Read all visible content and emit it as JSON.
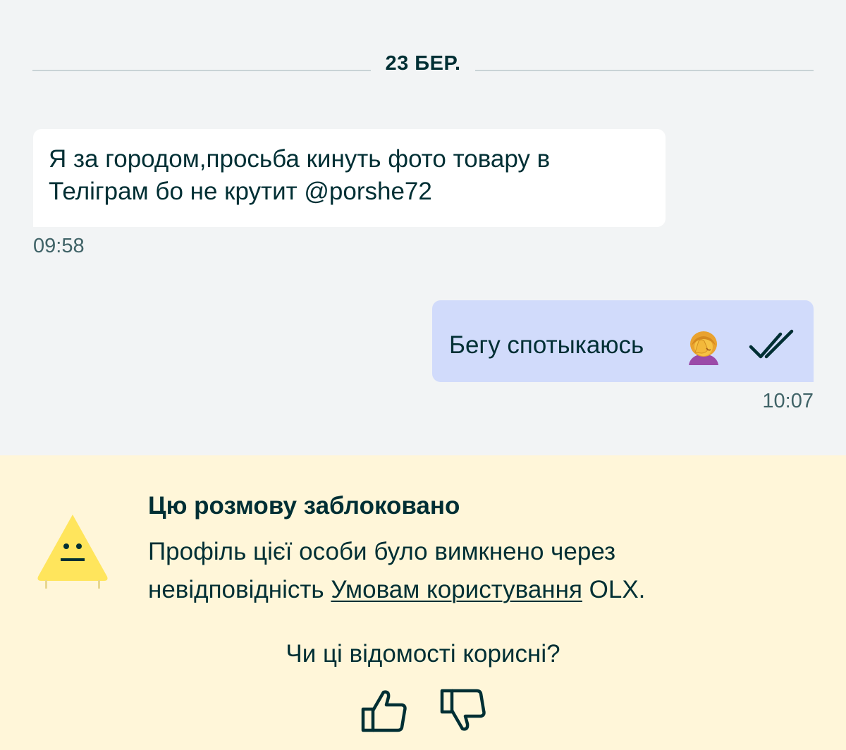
{
  "date_separator": "23 БЕР.",
  "messages": [
    {
      "direction": "incoming",
      "text_line1": "Я за городом,просьба кинуть фото товару в",
      "text_line2": "Теліграм бо не крутит @porshe72",
      "time": "09:58"
    },
    {
      "direction": "outgoing",
      "text": "Бегу спотыкаюсь",
      "emoji_icon": "facepalm-woman-icon",
      "status_icon": "double-check-icon",
      "time": "10:07"
    }
  ],
  "blocked": {
    "title": "Цю розмову заблоковано",
    "desc_line1": "Профіль цієї особи було вимкнено через",
    "desc_prefix": "невідповідність ",
    "terms_link": "Умовам користування",
    "desc_suffix": " OLX.",
    "feedback_question": "Чи ці відомості корисні?",
    "warning_icon": "warning-sign-icon"
  },
  "colors": {
    "chat_bg": "#f2f4f5",
    "incoming_bubble": "#ffffff",
    "outgoing_bubble": "#d1dbfb",
    "blocked_bg": "#fff6d9",
    "warning_yellow": "#ffe55c",
    "text_dark": "#002f34"
  }
}
